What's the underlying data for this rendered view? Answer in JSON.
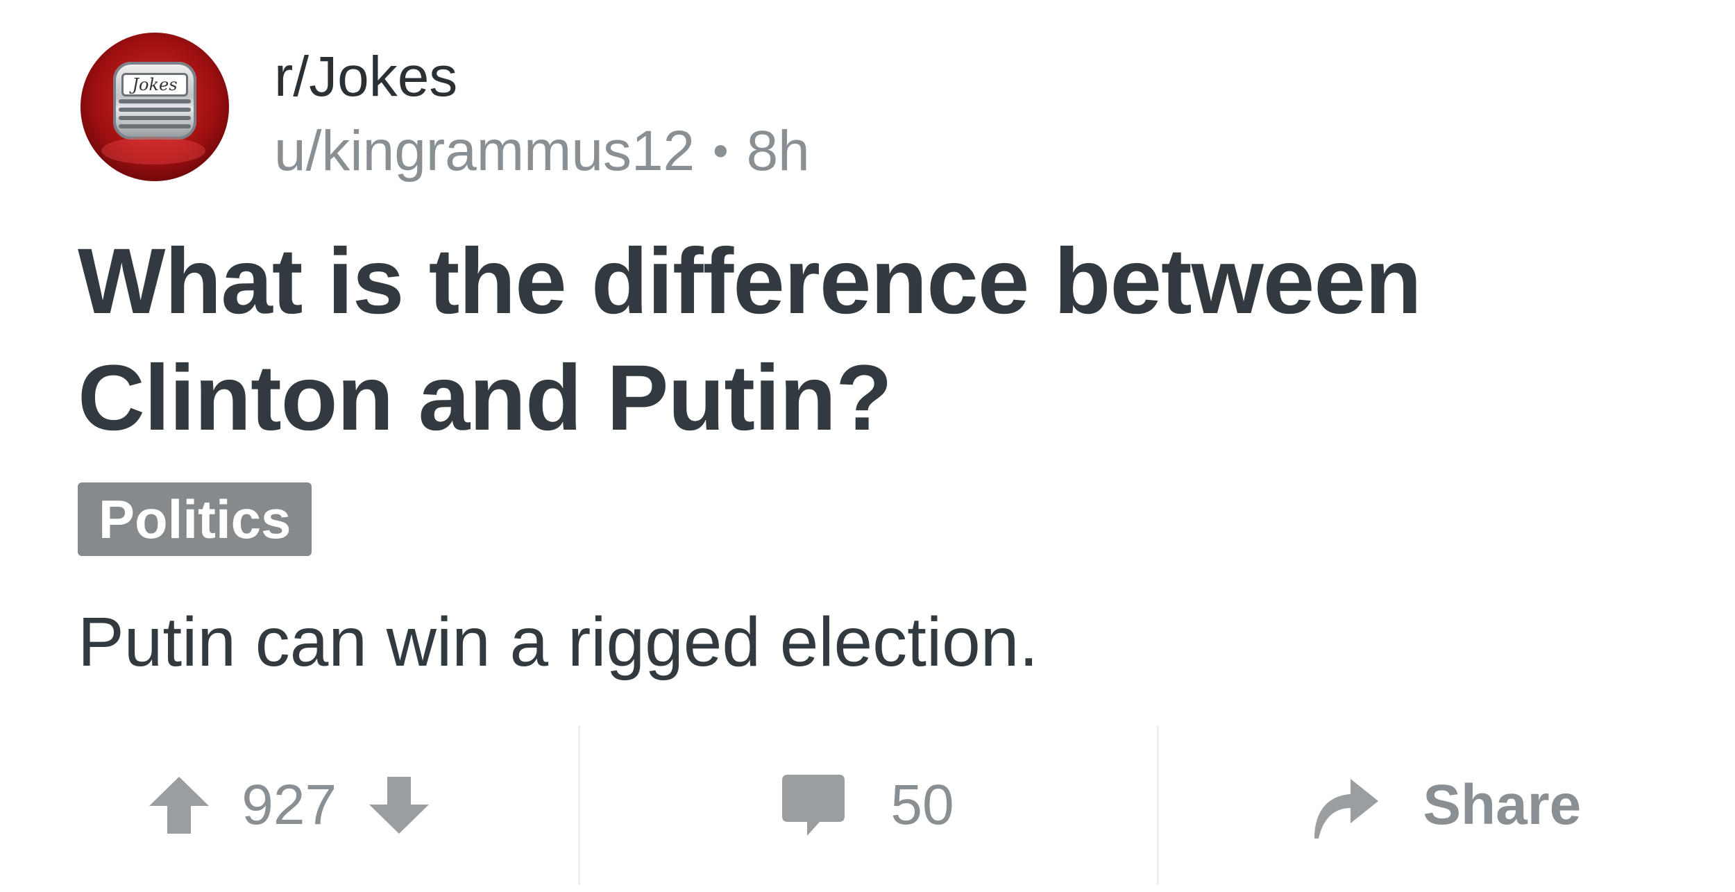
{
  "post": {
    "subreddit": "r/Jokes",
    "author": "u/kingrammus12",
    "separator": "•",
    "age": "8h",
    "avatar_text": "Jokes",
    "title": "What is the difference between Clinton and Putin?",
    "flair": "Politics",
    "body": "Putin can win a rigged election."
  },
  "actions": {
    "score": "927",
    "comment_count": "50",
    "share_label": "Share"
  },
  "icons": {
    "upvote": "arrow-up-icon",
    "downvote": "arrow-down-icon",
    "comment": "speech-bubble-icon",
    "share": "share-arrow-icon"
  },
  "colors": {
    "icon_gray": "#9b9ea1",
    "flair_bg": "#878a8c",
    "text_dark": "#333a3f",
    "text_muted": "#8a8f93"
  }
}
